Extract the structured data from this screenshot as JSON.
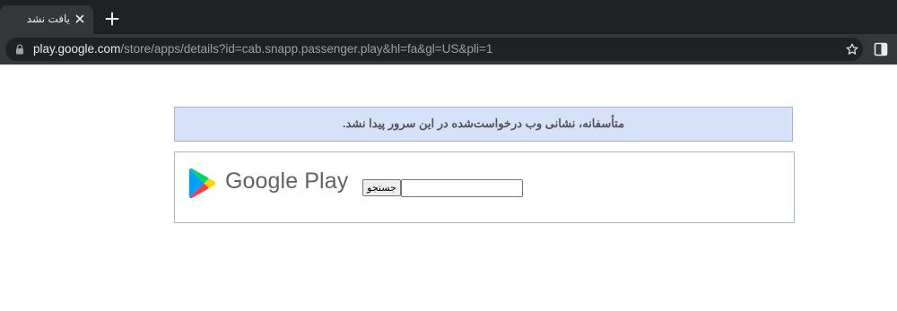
{
  "browser": {
    "tab": {
      "title": "یافت نشد"
    },
    "address_bar": {
      "host": "play.google.com",
      "path": "/store/apps/details?id=cab.snapp.passenger.play&hl=fa&gl=US&pli=1"
    },
    "icons": [
      "lock-icon",
      "close-icon",
      "plus-icon",
      "star-icon",
      "side-panel-icon"
    ]
  },
  "page": {
    "error_message": "متأسفانه، نشانی وب درخواست‌شده در این سرور پیدا نشد.",
    "logo": {
      "wordmark": "Google Play",
      "icon": "google-play-logo-icon"
    },
    "search": {
      "button_label": "جستجو",
      "value": ""
    }
  },
  "colors": {
    "error_background": "#d6e2fa",
    "box_border": "#a8b6cc",
    "browser_dark": "#202124",
    "browser_tab": "#35363a"
  }
}
